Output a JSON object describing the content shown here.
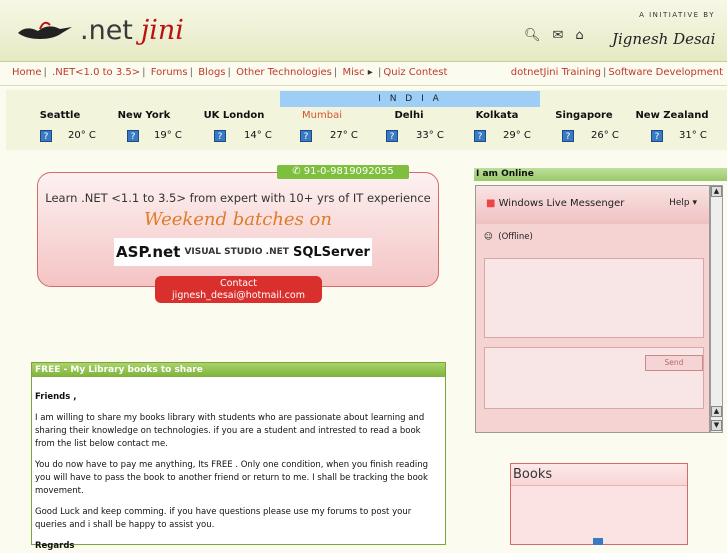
{
  "header": {
    "logo_net": ".net",
    "logo_jini": "jini",
    "initiative": "A INITIATIVE BY",
    "author": "Jignesh Desai",
    "icons": [
      "search-icon",
      "mail-icon",
      "home-icon"
    ]
  },
  "nav": {
    "items": [
      "Home",
      ".NET<1.0 to 3.5>",
      "Forums",
      "Blogs",
      "Other Technologies",
      "Misc",
      "Quiz Contest"
    ],
    "right": [
      "dotnetJini Training",
      "Software Development"
    ]
  },
  "weather": {
    "country": "I N D I A",
    "cities": [
      {
        "name": "Seattle",
        "temp": "20° C"
      },
      {
        "name": "New York",
        "temp": "19° C"
      },
      {
        "name": "UK London",
        "temp": "14° C"
      },
      {
        "name": "Mumbai",
        "temp": "27° C"
      },
      {
        "name": "Delhi",
        "temp": "33° C"
      },
      {
        "name": "Kolkata",
        "temp": "29° C"
      },
      {
        "name": "Singapore",
        "temp": "26° C"
      },
      {
        "name": "New Zealand",
        "temp": "31° C"
      }
    ]
  },
  "promo": {
    "phone": "✆ 91-0-9819092055",
    "title": "Learn .NET <1.1 to 3.5> from expert with 10+ yrs of  IT  experience",
    "weekend": "Weekend batches on",
    "logos": [
      "ASP.net",
      "VISUAL STUDIO .NET",
      "SQLServer"
    ],
    "contact_label": "Contact",
    "contact_email": "jignesh_desai@hotmail.com"
  },
  "library": {
    "header": "FREE - My Library books to share",
    "greeting": "Friends ,",
    "p1": "I am willing to share my books library with students who are passionate about learning and sharing their knowledge on technologies.  if you are a student and intrested to read a book from the list below contact me.",
    "p2": "You do now have to pay me anything, Its FREE .  Only one condition, when you finish reading you will have to pass the book to another friend or return to me.  I shall be tracking the book movement.",
    "p3": "Good Luck and keep comming. if you have questions please use my forums to post your queries and i shall be happy to assist you.",
    "regards": "Regards"
  },
  "online": {
    "header": "I am Online",
    "messenger_title": "Windows Live Messenger",
    "help": "Help ▾",
    "status": "(Offline)",
    "send": "Send"
  },
  "books": {
    "header": "Books"
  }
}
